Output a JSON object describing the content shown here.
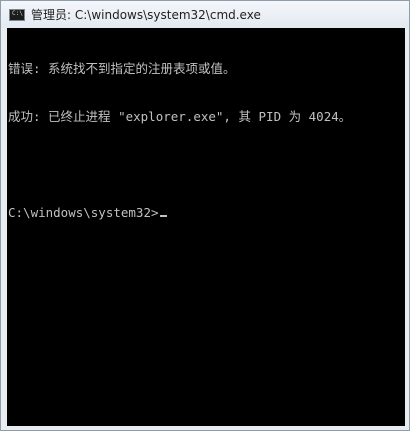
{
  "window": {
    "title": "管理员: C:\\windows\\system32\\cmd.exe",
    "icon_name": "cmd-icon",
    "icon_text": "C:\\"
  },
  "console": {
    "background": "#000000",
    "foreground": "#c0c0c0",
    "lines": [
      "错误: 系统找不到指定的注册表项或值。",
      "成功: 已终止进程 \"explorer.exe\", 其 PID 为 4024。",
      "",
      "C:\\windows\\system32>"
    ]
  }
}
